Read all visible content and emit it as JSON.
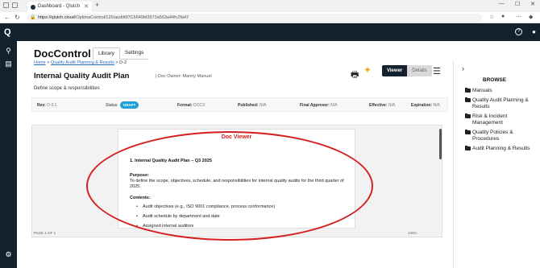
{
  "browser": {
    "tab_title": "Dashboard - Qlutch",
    "url_domain": "https://qlutch.cloud",
    "url_path": "/OptimaControl/125/audit6f7C6649bf3573a563a44fc2fa47"
  },
  "app": {
    "logo": "Q"
  },
  "header": {
    "app_name": "DocControl",
    "tabs": [
      {
        "label": "Library",
        "active": true
      },
      {
        "label": "Settings",
        "active": false
      }
    ]
  },
  "breadcrumb": {
    "home": "Home",
    "sep1": " > ",
    "section": "Quality Audit Planning & Results",
    "sep2": " > ",
    "current": "D-3"
  },
  "document": {
    "title": "Internal Quality Audit Plan",
    "owner": "| Doc Owner: Manny Manuel",
    "subtitle": "Define scope & responsibilities",
    "view_toggle": {
      "viewer": "Viewer",
      "details": "Details"
    },
    "meta": {
      "rev_label": "Rev:",
      "rev_value": "D-3.1",
      "status_label": "Status:",
      "status_value": "DRAFT",
      "format_label": "Format:",
      "format_value": "DOCX",
      "published_label": "Published:",
      "published_value": "N/A",
      "approver_label": "Final Approver:",
      "approver_value": "N/A",
      "effective_label": "Effective:",
      "effective_value": "N/A",
      "expiration_label": "Expiration:",
      "expiration_value": "N/A"
    }
  },
  "viewer": {
    "title": "Doc Viewer",
    "heading": "1. Internal Quality Audit Plan – Q3 2025",
    "purpose_label": "Purpose:",
    "purpose_text": "To define the scope, objectives, schedule, and responsibilities for internal quality audits for the third quarter of 2025.",
    "contents_label": "Contents:",
    "bullets": [
      "Audit objectives (e.g., ISO 9001 compliance, process conformance)",
      "Audit schedule by department and date",
      "Assigned internal auditors"
    ],
    "page_indicator": "PAGE 1 OF 1",
    "zoom": "100%"
  },
  "browse": {
    "title": "BROWSE",
    "items": [
      "Manuals",
      "Quality Audit Planning & Results",
      "Risk & Incident Management",
      "Quality Policies & Procedures",
      "Audit Planning & Results"
    ]
  },
  "colors": {
    "header_bg": "#13212e",
    "draft_badge": "#1e9fd8",
    "annotation": "#d31f1f",
    "link": "#2a6ebb"
  },
  "icons": [
    "back-icon",
    "forward-icon",
    "refresh-icon",
    "help-icon",
    "user-icon",
    "sitemap-icon",
    "documents-icon",
    "settings-icon",
    "print-icon",
    "ai-sparkle-icon",
    "hamburger-icon",
    "chevron-right-icon",
    "folder-icon"
  ]
}
